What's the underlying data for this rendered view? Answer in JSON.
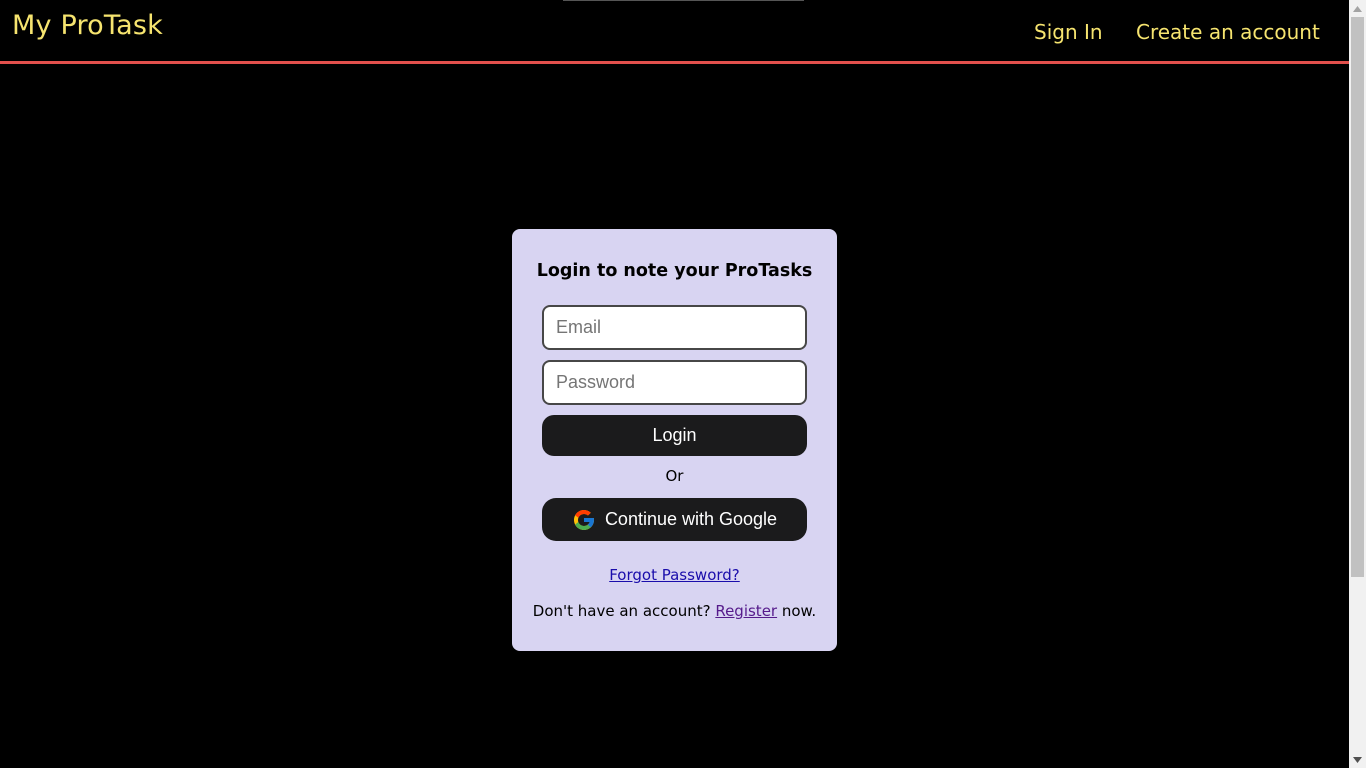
{
  "navbar": {
    "brand": "My ProTask",
    "links": {
      "sign_in": "Sign In",
      "create_account": "Create an account"
    }
  },
  "login_card": {
    "title": "Login to note your ProTasks",
    "email": {
      "placeholder": "Email",
      "value": ""
    },
    "password": {
      "placeholder": "Password",
      "value": ""
    },
    "login_button": "Login",
    "or_text": "Or",
    "google_button": "Continue with Google",
    "forgot_password": "Forgot Password?",
    "register_prefix": "Don't have an account? ",
    "register_link": "Register",
    "register_suffix": " now."
  },
  "colors": {
    "background": "#000000",
    "brand_text": "#f6e46f",
    "navbar_border": "#e2504c",
    "card_background": "#d8d4f2",
    "button_background": "#1b1b1c",
    "link": "#1a0dab"
  },
  "icons": {
    "google": "google-g-icon",
    "scroll_up": "scroll-up-arrow-icon",
    "scroll_down": "scroll-down-arrow-icon"
  }
}
